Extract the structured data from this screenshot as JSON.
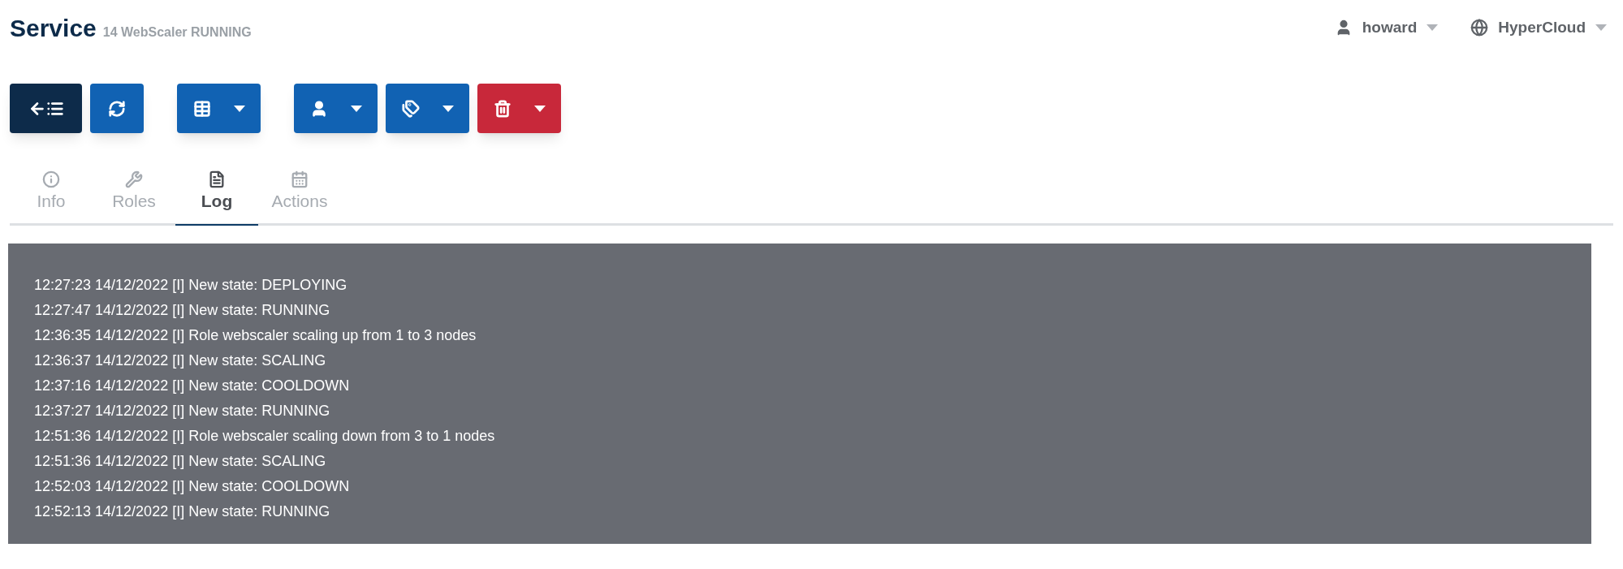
{
  "header": {
    "title": "Service",
    "subtitle": "14 WebScaler RUNNING",
    "menus": [
      {
        "kind": "user",
        "label": "howard"
      },
      {
        "kind": "cloud",
        "label": "HyperCloud"
      }
    ]
  },
  "toolbar": [
    {
      "kind": "back"
    },
    {
      "kind": "refresh"
    },
    {
      "kind": "table"
    },
    {
      "kind": "user"
    },
    {
      "kind": "tags"
    },
    {
      "kind": "delete"
    }
  ],
  "tabs": [
    {
      "kind": "info",
      "label": "Info",
      "selected": false
    },
    {
      "kind": "roles",
      "label": "Roles",
      "selected": false
    },
    {
      "kind": "log",
      "label": "Log",
      "selected": true
    },
    {
      "kind": "actions",
      "label": "Actions",
      "selected": false
    }
  ],
  "log": [
    "12:27:23 14/12/2022 [I] New state: DEPLOYING",
    "12:27:47 14/12/2022 [I] New state: RUNNING",
    "12:36:35 14/12/2022 [I] Role webscaler scaling up from 1 to 3 nodes",
    "12:36:37 14/12/2022 [I] New state: SCALING",
    "12:37:16 14/12/2022 [I] New state: COOLDOWN",
    "12:37:27 14/12/2022 [I] New state: RUNNING",
    "12:51:36 14/12/2022 [I] Role webscaler scaling down from 3 to 1 nodes",
    "12:51:36 14/12/2022 [I] New state: SCALING",
    "12:52:03 14/12/2022 [I] New state: COOLDOWN",
    "12:52:13 14/12/2022 [I] New state: RUNNING"
  ]
}
